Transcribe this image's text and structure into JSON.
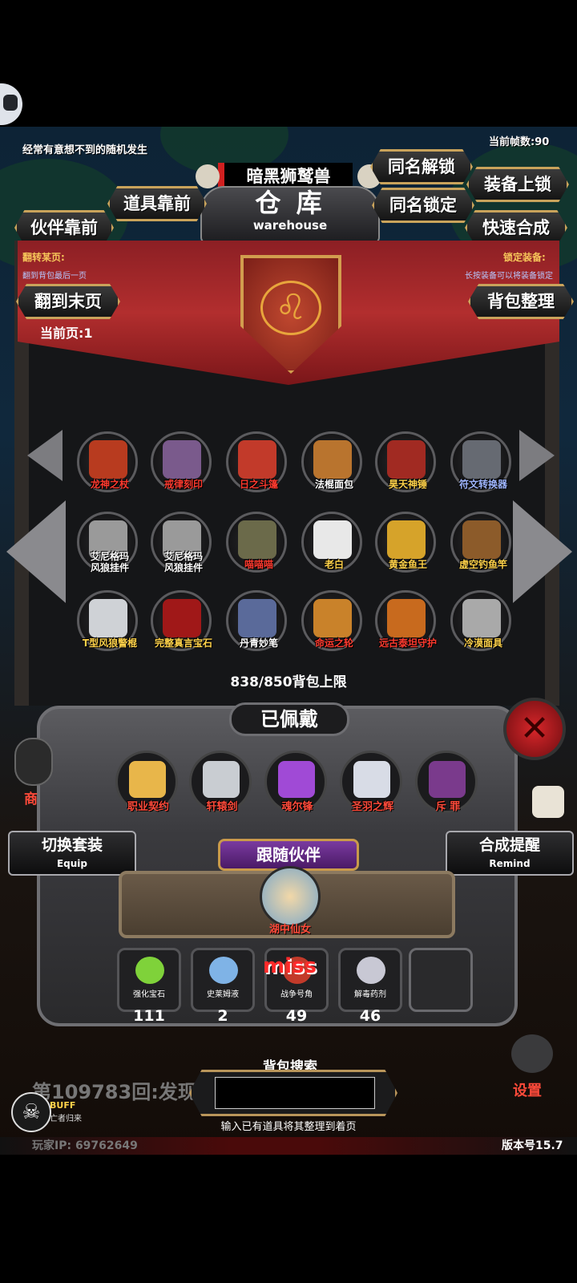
{
  "top_note": "经常有意想不到的随机发生",
  "fps": "当前帧数:90",
  "boss_name": "暗黑狮鹫兽",
  "warehouse": {
    "title": "仓 库",
    "subtitle": "warehouse"
  },
  "buttons": {
    "same_name_unlock": "同名解锁",
    "equip_lock": "装备上锁",
    "item_front": "道具靠前",
    "same_name_lock": "同名锁定",
    "partner_front": "伙伴靠前",
    "quick_merge": "快速合成",
    "last_page": "翻到末页",
    "sort_bag": "背包整理",
    "switch_set": "切换套装",
    "switch_set_sub": "Equip",
    "merge_remind": "合成提醒",
    "merge_remind_sub": "Remind"
  },
  "flip_page": {
    "label": "翻转某页:",
    "desc": "翻到背包最后一页"
  },
  "lock_equip": {
    "label": "锁定装备:",
    "desc": "长按装备可以将装备锁定"
  },
  "current_page": "当前页:1",
  "items": [
    {
      "name": "龙神之杖",
      "color": "red",
      "icon_color": "#b83b1f"
    },
    {
      "name": "戒律刻印",
      "color": "red",
      "icon_color": "#7a5a8c"
    },
    {
      "name": "日之斗篷",
      "color": "red",
      "icon_color": "#c23a2a"
    },
    {
      "name": "法棍面包",
      "color": "wht",
      "icon_color": "#b9742e"
    },
    {
      "name": "昊天神锤",
      "color": "gold",
      "icon_color": "#a12a22"
    },
    {
      "name": "符文转换器",
      "color": "blu",
      "icon_color": "#666a72"
    },
    {
      "name": "艾尼格玛\n风狼挂件",
      "color": "wht",
      "icon_color": "#9a9a9a"
    },
    {
      "name": "艾尼格玛\n风狼挂件",
      "color": "wht",
      "icon_color": "#9a9a9a"
    },
    {
      "name": "喵喵喵",
      "color": "red",
      "icon_color": "#6b6a4a"
    },
    {
      "name": "老白",
      "color": "gold",
      "icon_color": "#e8e8e8"
    },
    {
      "name": "黄金鱼王",
      "color": "gold",
      "icon_color": "#d6a32a"
    },
    {
      "name": "虚空钓鱼竿",
      "color": "gold",
      "icon_color": "#8c5b2a"
    },
    {
      "name": "T型风狼警棍",
      "color": "gold",
      "icon_color": "#cfd2d6"
    },
    {
      "name": "完整真言宝石",
      "color": "gold",
      "icon_color": "#a01818"
    },
    {
      "name": "丹青妙笔",
      "color": "wht",
      "icon_color": "#5a6a9a"
    },
    {
      "name": "命运之轮",
      "color": "red",
      "icon_color": "#c9822a"
    },
    {
      "name": "远古泰坦守护",
      "color": "red",
      "icon_color": "#c86a1e"
    },
    {
      "name": "冷漠面具",
      "color": "gold",
      "icon_color": "#a9a9a9"
    }
  ],
  "bag_limit": "838/850背包上限",
  "equipped_title": "已佩戴",
  "equipped": [
    {
      "name": "职业契约",
      "icon_color": "#e8b64a"
    },
    {
      "name": "轩辕剑",
      "icon_color": "#c9cdd2"
    },
    {
      "name": "魂尔锋",
      "icon_color": "#a04ad6"
    },
    {
      "name": "圣羽之辉",
      "color": "",
      "icon_color": "#d8dce6"
    },
    {
      "name": "斥 罪",
      "icon_color": "#7a3a8c"
    }
  ],
  "follow_partner": "跟随伙伴",
  "partner_name": "湖中仙女",
  "consumables": [
    {
      "name": "强化宝石",
      "count": "111",
      "icon_color": "#7fd23a"
    },
    {
      "name": "史莱姆液",
      "count": "2",
      "icon_color": "#7fb3e6"
    },
    {
      "name": "战争号角",
      "count": "49",
      "icon_color": "#c23a2a"
    },
    {
      "name": "解毒药剂",
      "count": "46",
      "icon_color": "#c8c8d4"
    }
  ],
  "miss_text": "miss",
  "round_text": "第109783回:发现",
  "buff": {
    "label": "BUFF",
    "desc": "亡者归来"
  },
  "search": {
    "title": "背包搜索",
    "hint": "输入已有道具将其整理到着页",
    "value": ""
  },
  "side_texts": {
    "shop": "商",
    "settings": "设置"
  },
  "player_ip": "玩家IP:  69762649",
  "version": "版本号15.7"
}
